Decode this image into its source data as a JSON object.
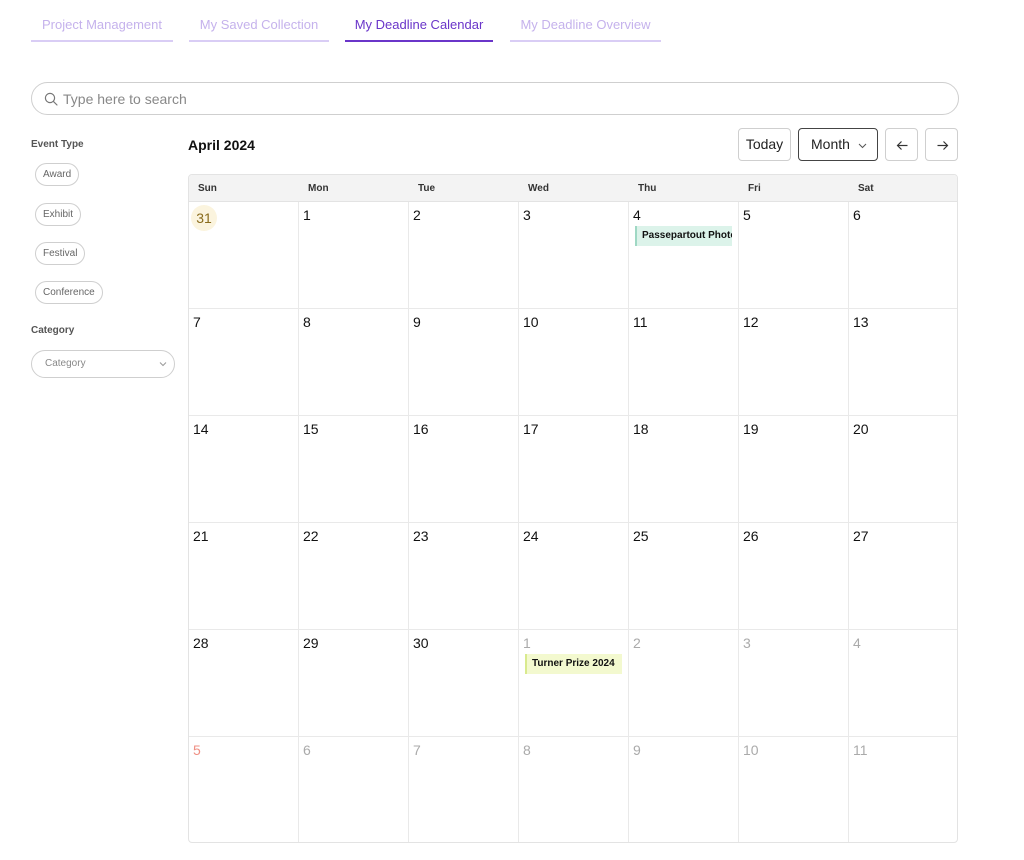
{
  "tabs": [
    {
      "label": "Project Management",
      "active": false
    },
    {
      "label": "My Saved Collection",
      "active": false
    },
    {
      "label": "My Deadline Calendar",
      "active": true
    },
    {
      "label": "My Deadline Overview",
      "active": false
    }
  ],
  "search": {
    "placeholder": "Type here to search",
    "value": ""
  },
  "sidebar": {
    "event_type_heading": "Event Type",
    "event_types": [
      "Award",
      "Exhibit",
      "Festival",
      "Conference"
    ],
    "category_heading": "Category",
    "category_select": "Category"
  },
  "calendar": {
    "title": "April 2024",
    "today_label": "Today",
    "view_label": "Month",
    "weekdays": [
      "Sun",
      "Mon",
      "Tue",
      "Wed",
      "Thu",
      "Fri",
      "Sat"
    ],
    "weeks": [
      [
        {
          "d": "31",
          "m": "cur",
          "today": true
        },
        {
          "d": "1"
        },
        {
          "d": "2"
        },
        {
          "d": "3"
        },
        {
          "d": "4",
          "event": {
            "title": "Passepartout Photo Prize",
            "color": "green"
          }
        },
        {
          "d": "5"
        },
        {
          "d": "6"
        }
      ],
      [
        {
          "d": "7"
        },
        {
          "d": "8"
        },
        {
          "d": "9"
        },
        {
          "d": "10"
        },
        {
          "d": "11"
        },
        {
          "d": "12"
        },
        {
          "d": "13"
        }
      ],
      [
        {
          "d": "14"
        },
        {
          "d": "15"
        },
        {
          "d": "16"
        },
        {
          "d": "17"
        },
        {
          "d": "18"
        },
        {
          "d": "19"
        },
        {
          "d": "20"
        }
      ],
      [
        {
          "d": "21"
        },
        {
          "d": "22"
        },
        {
          "d": "23"
        },
        {
          "d": "24"
        },
        {
          "d": "25"
        },
        {
          "d": "26"
        },
        {
          "d": "27"
        }
      ],
      [
        {
          "d": "28"
        },
        {
          "d": "29"
        },
        {
          "d": "30"
        },
        {
          "d": "1",
          "m": "other",
          "event": {
            "title": "Turner Prize 2024",
            "color": "yellow"
          }
        },
        {
          "d": "2",
          "m": "other"
        },
        {
          "d": "3",
          "m": "other"
        },
        {
          "d": "4",
          "m": "other"
        }
      ],
      [
        {
          "d": "5",
          "m": "other",
          "red": true
        },
        {
          "d": "6",
          "m": "other"
        },
        {
          "d": "7",
          "m": "other"
        },
        {
          "d": "8",
          "m": "other"
        },
        {
          "d": "9",
          "m": "other"
        },
        {
          "d": "10",
          "m": "other"
        },
        {
          "d": "11",
          "m": "other"
        }
      ]
    ]
  },
  "colors": {
    "accent": "#6a35c9",
    "tab_inactive": "#c5b2ec",
    "event_green": "#dcf3ea",
    "event_yellow": "#f3f9cf",
    "today_highlight": "#fbf4de"
  }
}
